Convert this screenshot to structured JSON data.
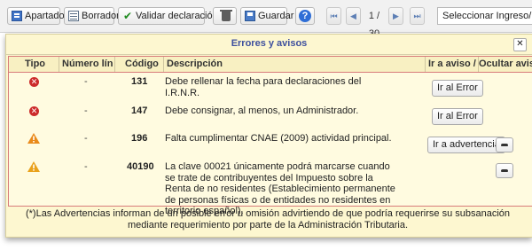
{
  "toolbar": {
    "apartados": "Apartados",
    "borrador": "Borrador",
    "validar": "Validar declaración",
    "guardar": "Guardar",
    "help": "?",
    "first": "⏮",
    "prev": "◀",
    "page": "1 / 30",
    "next": "▶",
    "last": "⏭",
    "select_value": "Seleccionar Ingreso/Dev"
  },
  "panel": {
    "title": "Errores y avisos",
    "close": "✕",
    "headers": {
      "tipo": "Tipo",
      "numero": "Número línea",
      "codigo": "Código",
      "descripcion": "Descripción",
      "ir": "Ir a aviso / error",
      "ocultar": "Ocultar aviso"
    },
    "rows": [
      {
        "type": "error",
        "line": "-",
        "code": "131",
        "description": "Debe rellenar la fecha para declaraciones del I.R.N.R.",
        "action": "Ir al Error",
        "hide": false
      },
      {
        "type": "error",
        "line": "-",
        "code": "147",
        "description": "Debe consignar, al menos, un Administrador.",
        "action": "Ir al Error",
        "hide": false
      },
      {
        "type": "warning",
        "line": "-",
        "code": "196",
        "description": "Falta cumplimentar CNAE (2009) actividad principal.",
        "action": "Ir a advertencia",
        "hide": true
      },
      {
        "type": "warning",
        "line": "-",
        "code": "40190",
        "description": "La clave 00021 únicamente podrá marcarse cuando se trate de contribuyentes del Impuesto sobre la Renta de no residentes (Establecimiento permanente de personas físicas o de entidades no residentes en territorio español).",
        "action": "",
        "hide": true
      }
    ],
    "footnote": "(*)Las Advertencias informan de un posible error u omisión advirtiendo de que podría requerirse su subsanación mediante requerimiento por parte de la Administración Tributaria."
  },
  "colors": {
    "panel_bg": "#fdf7d0",
    "title": "#3d4f9e",
    "error": "#cc2b2b",
    "warning": "#e98a1a",
    "table_border": "#d87b7b"
  },
  "icons": [
    "apartados-icon",
    "borrador-icon",
    "check-icon",
    "trash-icon",
    "save-icon",
    "help-icon",
    "error-icon",
    "warning-icon",
    "eye-icon",
    "close-icon"
  ]
}
